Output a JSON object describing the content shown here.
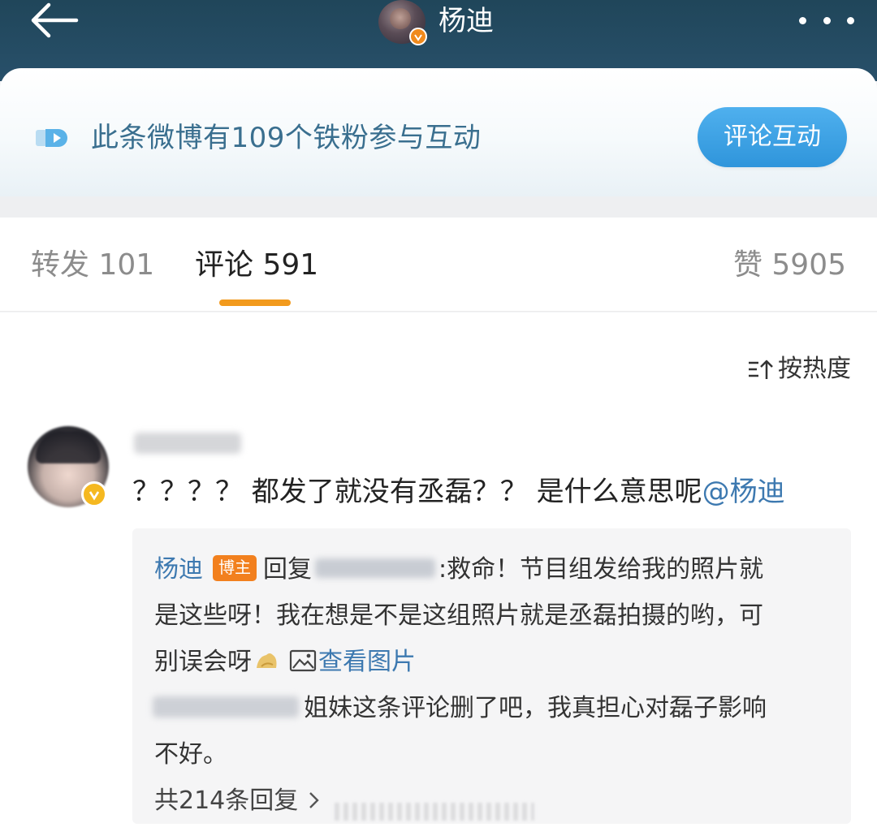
{
  "header": {
    "title": "杨迪",
    "accent": "#20465a"
  },
  "fan_banner": {
    "text": "此条微博有109个铁粉参与互动",
    "button_label": "评论互动"
  },
  "tabs": {
    "repost": "转发 101",
    "comment": "评论 591",
    "like": "赞 5905",
    "active": "comment",
    "indicator_color": "#f29a1d"
  },
  "sort": {
    "label": "按热度"
  },
  "comment": {
    "text_prefix": "？？？？ 都发了就没有丞磊？？ 是什么意思呢",
    "mention": "@杨迪",
    "reply": {
      "author": "杨迪",
      "author_tag": "博主",
      "reply_word": "回复",
      "line1_rest": ":救命！节目组发给我的照片就",
      "line2": "是这些呀！我在想是不是这组照片就是丞磊拍摄的哟，可",
      "line3": "别误会呀",
      "view_pic": "查看图片",
      "sub_reply_line1": "姐妹这条评论删了吧，我真担心对磊子影响",
      "sub_reply_line2": "不好。",
      "total_replies": "共214条回复"
    }
  },
  "icons": [
    "back-arrow-icon",
    "more-dots-icon",
    "verified-badge-icon",
    "fan-badge-icon",
    "sort-icon",
    "emoji-icon",
    "picture-icon",
    "chevron-right-icon"
  ]
}
